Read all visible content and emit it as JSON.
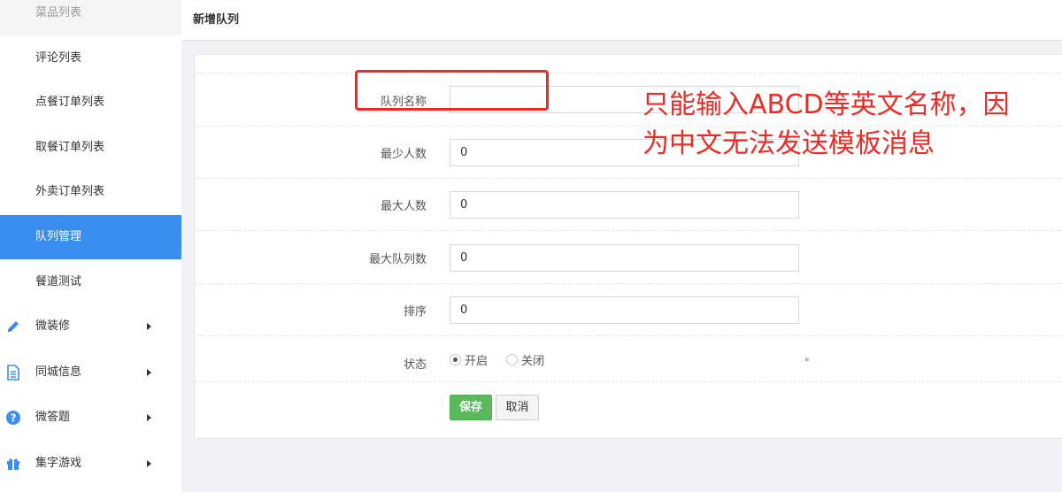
{
  "sidebar": {
    "sub_items": [
      {
        "label": "菜品列表"
      },
      {
        "label": "评论列表"
      },
      {
        "label": "点餐订单列表"
      },
      {
        "label": "取餐订单列表"
      },
      {
        "label": "外卖订单列表"
      },
      {
        "label": "队列管理",
        "active": true
      },
      {
        "label": "餐道测试"
      }
    ],
    "menus": [
      {
        "label": "微装修",
        "icon": "pencil-icon"
      },
      {
        "label": "同城信息",
        "icon": "document-icon"
      },
      {
        "label": "微答题",
        "icon": "question-icon"
      },
      {
        "label": "集字游戏",
        "icon": "gift-icon"
      }
    ]
  },
  "header": {
    "title": "新增队列"
  },
  "form": {
    "fields": [
      {
        "label": "队列名称",
        "value": ""
      },
      {
        "label": "最少人数",
        "value": "0"
      },
      {
        "label": "最大人数",
        "value": "0"
      },
      {
        "label": "最大队列数",
        "value": "0"
      },
      {
        "label": "排序",
        "value": "0"
      }
    ],
    "status": {
      "label": "状态",
      "options": [
        {
          "label": "开启",
          "checked": true
        },
        {
          "label": "关闭",
          "checked": false
        }
      ],
      "required_mark": "*"
    },
    "save_label": "保存",
    "cancel_label": "取消"
  },
  "annotation": {
    "note": "只能输入ABCD等英文名称，因\n为中文无法发送模板消息",
    "color": "#ee2a24"
  },
  "colors": {
    "active_menu": "#3a8ef0",
    "save_button": "#5cb85c",
    "icon_blue": "#3a8ef0"
  }
}
